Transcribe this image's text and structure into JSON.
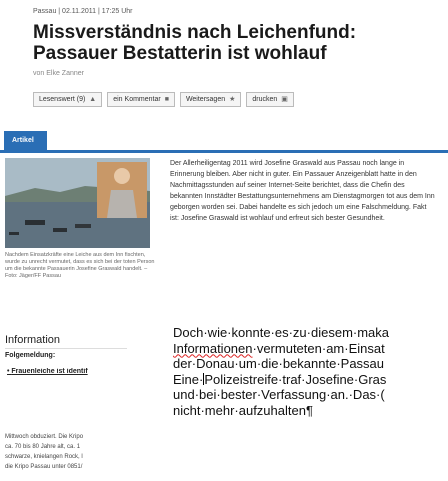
{
  "meta": "Passau | 02.11.2011 | 17:25 Uhr",
  "title_line1": "Missverständnis nach Leichenfund:",
  "title_line2": "Passauer Bestatterin ist wohlauf",
  "author": "von Elke Zanner",
  "toolbar": {
    "lesenswert": "Lesenswert (9)",
    "kommentar": "ein Kommentar",
    "weitersagen": "Weitersagen",
    "drucken": "drucken"
  },
  "tab": "Artikel",
  "caption": "Nachdem Einsatzkräfte eine Leiche aus dem Inn fischten, wurde zu unrecht vermutet, dass es sich bei der toten Person um die bekannte Passauerin Josefine Graswald handelt. – Foto: Jäger/FF Passau",
  "body": "Der Allerheiligentag 2011 wird Josefine Graswald aus Passau noch lange in Erinnerung bleiben. Aber nicht in guter. Ein Passauer Anzeigenblatt hatte in den Nachmittagsstunden auf seiner Internet-Seite berichtet, dass die Chefin des bekannten Innstädter Bestattungsunternehmens am Dienstagmorgen tot aus dem Inn geborgen worden sei. Dabei handelte es sich jedoch um eine Falschmeldung. Fakt ist: Josefine Graswald ist wohlauf und erfreut sich bester Gesundheit.",
  "info": {
    "heading": "Information",
    "sub": "Folgemeldung:",
    "link": "Frauenleiche ist identif"
  },
  "lower": [
    "Mittwoch obduziert. Die Kripo",
    "ca. 70 bis 80 Jahre alt, ca. 1",
    "schwarze, knielangen Rock, l",
    "die Kripo Passau unter 0851/"
  ],
  "word": {
    "line1": "Doch·wie·konnte·es·zu·diesem·maka",
    "line2a": "Informationen",
    "line2b": "·vermuteten·am·Einsat",
    "line3": "der·Donau·um·die·bekannte·Passau",
    "line4a": "Eine·",
    "line4b": "Polizeistreife·traf·Josefine·Gras",
    "line5": "und·bei·bester·Verfassung·an.·Das·(",
    "line6": "nicht·mehr·aufzuhalten¶"
  }
}
